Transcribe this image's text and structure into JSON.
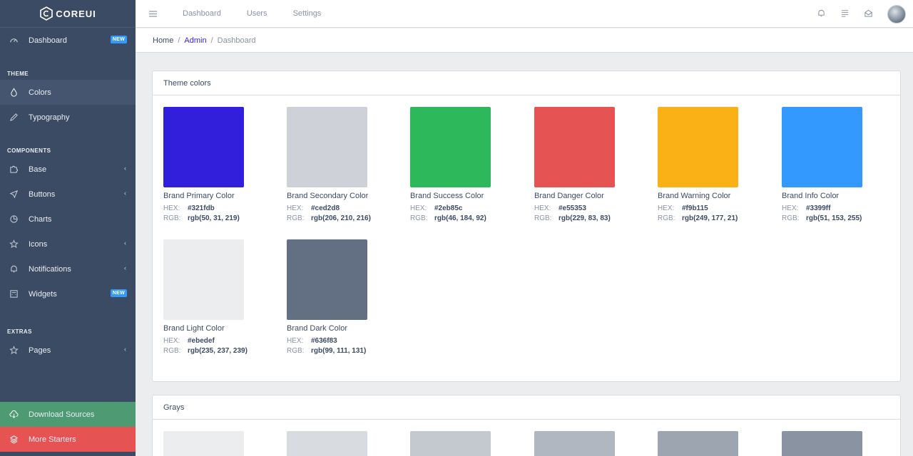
{
  "brand": {
    "text": "COREUI"
  },
  "sidebar": {
    "dashboard": {
      "label": "Dashboard",
      "badge": "NEW"
    },
    "section_theme": "THEME",
    "colors": "Colors",
    "typography": "Typography",
    "section_components": "COMPONENTS",
    "base": "Base",
    "buttons": "Buttons",
    "charts": "Charts",
    "icons": "Icons",
    "notifications": "Notifications",
    "widgets": {
      "label": "Widgets",
      "badge": "NEW"
    },
    "section_extras": "EXTRAS",
    "pages": "Pages",
    "download": "Download Sources",
    "starters": "More Starters"
  },
  "header": {
    "links": [
      "Dashboard",
      "Users",
      "Settings"
    ]
  },
  "breadcrumb": {
    "home": "Home",
    "admin": "Admin",
    "current": "Dashboard",
    "sep": "/"
  },
  "theme_card": {
    "title": "Theme colors",
    "hex_label": "HEX:",
    "rgb_label": "RGB:",
    "colors": [
      {
        "name": "Brand Primary Color",
        "hex": "#321fdb",
        "rgb": "rgb(50, 31, 219)"
      },
      {
        "name": "Brand Secondary Color",
        "hex": "#ced2d8",
        "rgb": "rgb(206, 210, 216)"
      },
      {
        "name": "Brand Success Color",
        "hex": "#2eb85c",
        "rgb": "rgb(46, 184, 92)"
      },
      {
        "name": "Brand Danger Color",
        "hex": "#e55353",
        "rgb": "rgb(229, 83, 83)"
      },
      {
        "name": "Brand Warning Color",
        "hex": "#f9b115",
        "rgb": "rgb(249, 177, 21)"
      },
      {
        "name": "Brand Info Color",
        "hex": "#3399ff",
        "rgb": "rgb(51, 153, 255)"
      },
      {
        "name": "Brand Light Color",
        "hex": "#ebedef",
        "rgb": "rgb(235, 237, 239)"
      },
      {
        "name": "Brand Dark Color",
        "hex": "#636f83",
        "rgb": "rgb(99, 111, 131)"
      }
    ]
  },
  "grays_card": {
    "title": "Grays",
    "swatch_colors": [
      "#ebedef",
      "#d8dbe0",
      "#c4c9d0",
      "#b1b7c1",
      "#9da5b1",
      "#8a93a2"
    ]
  },
  "colors": {
    "sidebar_bg": "#3c4b64",
    "download_bg": "#4e9a73",
    "starters_bg": "#e55353",
    "accent": "#321fdb"
  }
}
